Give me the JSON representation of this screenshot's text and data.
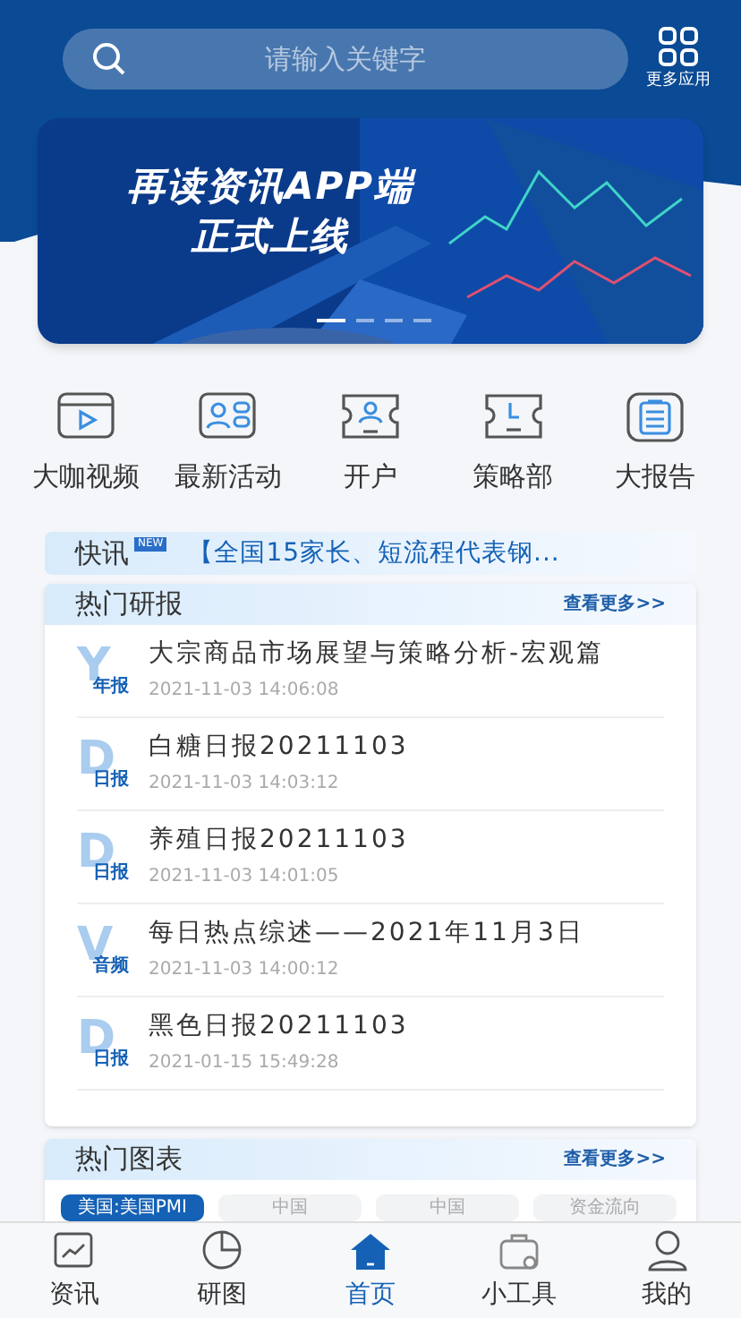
{
  "search": {
    "placeholder": "请输入关键字"
  },
  "more_apps": {
    "label": "更多应用"
  },
  "banner": {
    "kind": "picture",
    "title_lines": [
      "再读资讯APP端",
      "正式上线"
    ],
    "dots": [
      {
        "selected": true
      },
      {
        "selected": false
      },
      {
        "selected": false
      },
      {
        "selected": false
      }
    ]
  },
  "shortcuts": [
    {
      "label": "大咖视频",
      "kind": "video"
    },
    {
      "label": "最新活动",
      "kind": "activity"
    },
    {
      "label": "开户",
      "kind": "account"
    },
    {
      "label": "策略部",
      "kind": "strategy"
    },
    {
      "label": "大报告",
      "kind": "report"
    }
  ],
  "news_flash": {
    "label": "快讯",
    "badge": "NEW",
    "text": "【全国15家长、短流程代表钢..."
  },
  "hot_reports": {
    "title": "热门研报",
    "more": "查看更多>>",
    "rows": [
      {
        "letter": "Y",
        "tag": "年报",
        "title": "大宗商品市场展望与策略分析-宏观篇",
        "time": "2021-11-03 14:06:08"
      },
      {
        "letter": "D",
        "tag": "日报",
        "title": "白糖日报20211103",
        "time": "2021-11-03 14:03:12"
      },
      {
        "letter": "D",
        "tag": "日报",
        "title": "养殖日报20211103",
        "time": "2021-11-03 14:01:05"
      },
      {
        "letter": "V",
        "tag": "音频",
        "title": "每日热点综述——2021年11月3日",
        "time": "2021-11-03 14:00:12"
      },
      {
        "letter": "D",
        "tag": "日报",
        "title": "黑色日报20211103",
        "time": "2021-01-15 15:49:28"
      }
    ]
  },
  "hot_charts": {
    "title": "热门图表",
    "more": "查看更多>>",
    "tabs": [
      {
        "label": "美国:美国PMI",
        "selected": true
      },
      {
        "label": "中国",
        "selected": false
      },
      {
        "label": "中国",
        "selected": false
      },
      {
        "label": "资金流向",
        "selected": false
      }
    ]
  },
  "bottom_nav": [
    {
      "label": "资讯",
      "kind": "news",
      "selected": false
    },
    {
      "label": "研图",
      "kind": "chart",
      "selected": false
    },
    {
      "label": "首页",
      "kind": "home",
      "selected": true
    },
    {
      "label": "小工具",
      "kind": "tools",
      "selected": false
    },
    {
      "label": "我的",
      "kind": "me",
      "selected": false
    }
  ]
}
